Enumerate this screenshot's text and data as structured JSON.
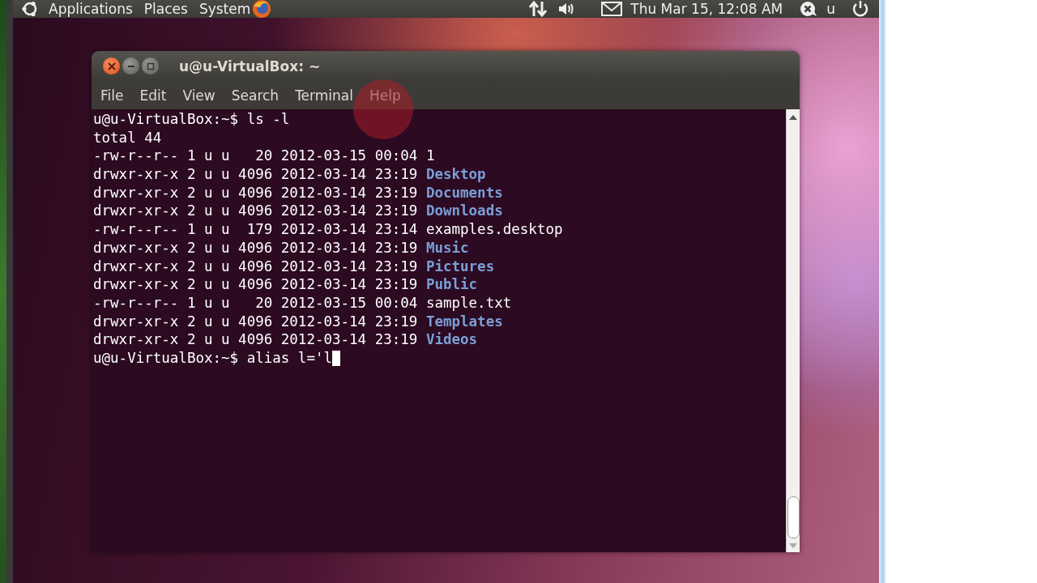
{
  "top_panel": {
    "menus": [
      "Applications",
      "Places",
      "System"
    ],
    "clock": "Thu Mar 15, 12:08 AM",
    "user": "u"
  },
  "terminal": {
    "title": "u@u-VirtualBox: ~",
    "menu": [
      "File",
      "Edit",
      "View",
      "Search",
      "Terminal",
      "Help"
    ],
    "lines": [
      {
        "kind": "text",
        "text": "u@u-VirtualBox:~$ ls -l"
      },
      {
        "kind": "text",
        "text": "total 44"
      },
      {
        "kind": "entry",
        "info": "-rw-r--r-- 1 u u   20 2012-03-15 00:04",
        "name": "1",
        "directory": false
      },
      {
        "kind": "entry",
        "info": "drwxr-xr-x 2 u u 4096 2012-03-14 23:19",
        "name": "Desktop",
        "directory": true
      },
      {
        "kind": "entry",
        "info": "drwxr-xr-x 2 u u 4096 2012-03-14 23:19",
        "name": "Documents",
        "directory": true
      },
      {
        "kind": "entry",
        "info": "drwxr-xr-x 2 u u 4096 2012-03-14 23:19",
        "name": "Downloads",
        "directory": true
      },
      {
        "kind": "entry",
        "info": "-rw-r--r-- 1 u u  179 2012-03-14 23:14",
        "name": "examples.desktop",
        "directory": false
      },
      {
        "kind": "entry",
        "info": "drwxr-xr-x 2 u u 4096 2012-03-14 23:19",
        "name": "Music",
        "directory": true
      },
      {
        "kind": "entry",
        "info": "drwxr-xr-x 2 u u 4096 2012-03-14 23:19",
        "name": "Pictures",
        "directory": true
      },
      {
        "kind": "entry",
        "info": "drwxr-xr-x 2 u u 4096 2012-03-14 23:19",
        "name": "Public",
        "directory": true
      },
      {
        "kind": "entry",
        "info": "-rw-r--r-- 1 u u   20 2012-03-15 00:04",
        "name": "sample.txt",
        "directory": false
      },
      {
        "kind": "entry",
        "info": "drwxr-xr-x 2 u u 4096 2012-03-14 23:19",
        "name": "Templates",
        "directory": true
      },
      {
        "kind": "entry",
        "info": "drwxr-xr-x 2 u u 4096 2012-03-14 23:19",
        "name": "Videos",
        "directory": true
      },
      {
        "kind": "text",
        "text": "u@u-VirtualBox:~$ alias l='l",
        "cursor": true
      }
    ]
  }
}
